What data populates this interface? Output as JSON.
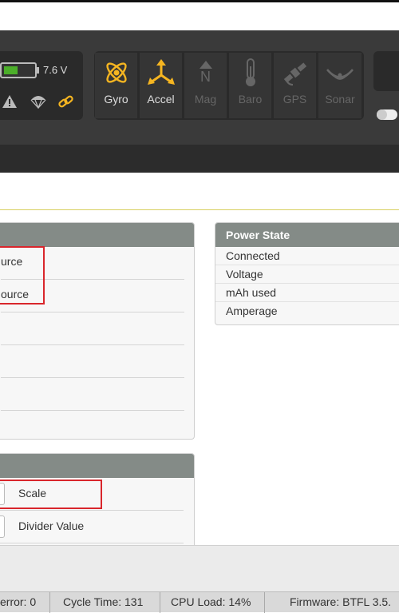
{
  "header": {
    "battery_voltage": "7.6 V",
    "battery_fill_fraction": 0.45,
    "status_icons": [
      "warning-icon",
      "parachute-icon",
      "link-icon"
    ],
    "sensors": [
      {
        "label": "Gyro",
        "active": true,
        "icon": "gyro-icon"
      },
      {
        "label": "Accel",
        "active": true,
        "icon": "accel-icon"
      },
      {
        "label": "Mag",
        "active": false,
        "icon": "mag-icon"
      },
      {
        "label": "Baro",
        "active": false,
        "icon": "baro-icon"
      },
      {
        "label": "GPS",
        "active": false,
        "icon": "gps-icon"
      },
      {
        "label": "Sonar",
        "active": false,
        "icon": "sonar-icon"
      }
    ],
    "mag_letter": "N",
    "active_color": "#f5b521",
    "inactive_color": "#6a6a6a"
  },
  "battery_panel": {
    "rows": [
      "urce",
      "ource"
    ]
  },
  "power_state": {
    "title": "Power State",
    "rows": [
      "Connected",
      "Voltage",
      "mAh used",
      "Amperage"
    ]
  },
  "current_panel": {
    "rows": [
      "Scale",
      "Divider Value"
    ]
  },
  "status_bar": {
    "items": [
      "error: 0",
      "Cycle Time: 131",
      "CPU Load: 14%",
      "Firmware: BTFL 3.5."
    ]
  }
}
